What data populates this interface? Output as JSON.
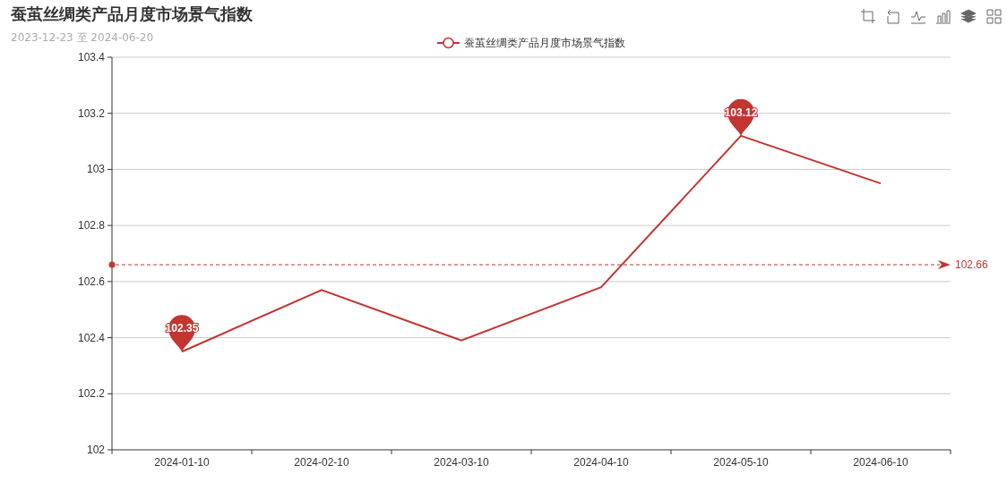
{
  "title": "蚕茧丝绸类产品月度市场景气指数",
  "subtitle": "2023-12-23 至 2024-06-20",
  "chart_data": {
    "type": "line",
    "grid": true,
    "categories": [
      "2024-01-10",
      "2024-02-10",
      "2024-03-10",
      "2024-04-10",
      "2024-05-10",
      "2024-06-10"
    ],
    "series": [
      {
        "name": "蚕茧丝绸类产品月度市场景气指数",
        "color": "#c23531",
        "values": [
          102.35,
          102.57,
          102.39,
          102.58,
          103.12,
          102.95
        ]
      }
    ],
    "ylim": [
      102,
      103.4
    ],
    "yticks": [
      {
        "value": 102,
        "label": "102"
      },
      {
        "value": 102.2,
        "label": "102.2"
      },
      {
        "value": 102.4,
        "label": "102.4"
      },
      {
        "value": 102.6,
        "label": "102.6"
      },
      {
        "value": 102.8,
        "label": "102.8"
      },
      {
        "value": 103,
        "label": "103"
      },
      {
        "value": 103.2,
        "label": "103.2"
      },
      {
        "value": 103.4,
        "label": "103.4"
      }
    ],
    "annotations": [
      {
        "text": "102.35",
        "x": "2024-01-10",
        "y": 102.35
      },
      {
        "text": "103.12",
        "x": "2024-05-10",
        "y": 103.12
      }
    ],
    "ref_lines": [
      {
        "axis": "y",
        "value": 102.66,
        "label": "102.66",
        "color": "#c23531"
      }
    ]
  }
}
